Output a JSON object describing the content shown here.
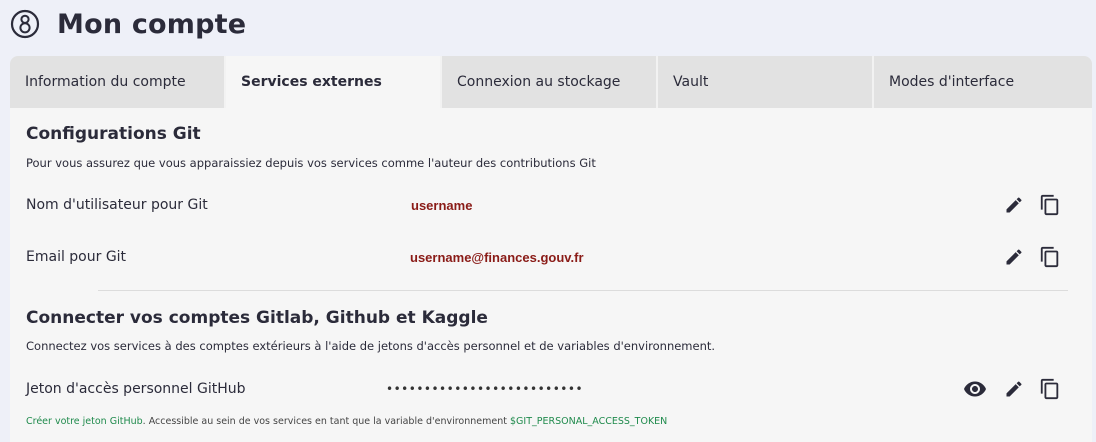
{
  "header": {
    "step_icon": "circled-eight-icon",
    "title": "Mon compte"
  },
  "tabs": [
    {
      "label": "Information du compte",
      "active": false
    },
    {
      "label": "Services externes",
      "active": true
    },
    {
      "label": "Connexion au stockage",
      "active": false
    },
    {
      "label": "Vault",
      "active": false
    },
    {
      "label": "Modes d'interface",
      "active": false
    }
  ],
  "git_config": {
    "title": "Configurations Git",
    "description": "Pour vous assurez que vous apparaissiez depuis vos services comme l'auteur des contributions Git",
    "username_label": "Nom d'utilisateur pour Git",
    "username_value": "username",
    "email_label": "Email pour Git",
    "email_value": "username@finances.gouv.fr"
  },
  "connect": {
    "title": "Connecter vos comptes Gitlab, Github et Kaggle",
    "description": "Connectez vos services à des comptes extérieurs à l'aide de jetons d'accès personnel et de variables d'environnement.",
    "github_token_label": "Jeton d'accès personnel GitHub",
    "github_token_value": "••••••••••••••••••••••••••",
    "helper_link": "Créer votre jeton GitHub",
    "helper_text": ". Accessible au sein de vos services en tant que la variable d'environnement ",
    "helper_var": "$GIT_PERSONAL_ACCESS_TOKEN"
  },
  "colors": {
    "value_text": "#8a1b17",
    "link": "#1f8a4c",
    "page_bg": "#eef0f8",
    "panel_bg": "#f6f6f6",
    "tab_bg": "#e2e2e2"
  },
  "icons": {
    "edit": "pencil-icon",
    "copy": "copy-icon",
    "show": "eye-icon"
  }
}
